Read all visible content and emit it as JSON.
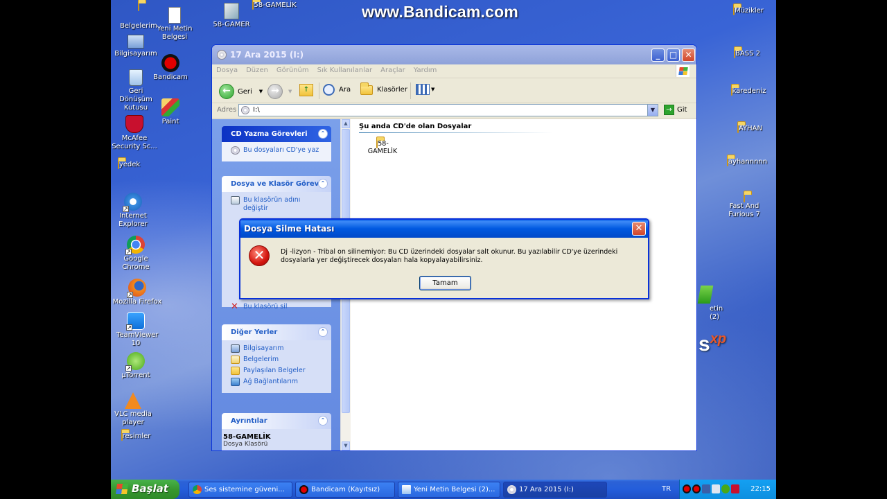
{
  "watermark": "www.Bandicam.com",
  "desktop_icons_left": [
    {
      "label": "Belgelerim",
      "icon": "my-documents-icon"
    },
    {
      "label": "Yeni Metin Belgesi",
      "icon": "text-document-icon"
    },
    {
      "label": "58-GAMER",
      "icon": "shortcut-icon"
    },
    {
      "label": "58-GAMELİK",
      "icon": "folder-icon"
    },
    {
      "label": "Bilgisayarım",
      "icon": "my-computer-icon"
    },
    {
      "label": "Bandicam",
      "icon": "bandicam-icon"
    },
    {
      "label": "Geri Dönüşüm Kutusu",
      "icon": "recycle-bin-icon"
    },
    {
      "label": "Paint",
      "icon": "paint-icon"
    },
    {
      "label": "McAfee Security Sc...",
      "icon": "mcafee-icon"
    },
    {
      "label": "yedek",
      "icon": "folder-icon"
    },
    {
      "label": "Internet Explorer",
      "icon": "internet-explorer-icon"
    },
    {
      "label": "Google Chrome",
      "icon": "chrome-icon"
    },
    {
      "label": "Mozilla Firefox",
      "icon": "firefox-icon"
    },
    {
      "label": "TeamViewer 10",
      "icon": "teamviewer-icon"
    },
    {
      "label": "µTorrent",
      "icon": "utorrent-icon"
    },
    {
      "label": "VLC media player",
      "icon": "vlc-icon"
    },
    {
      "label": "resimler",
      "icon": "folder-icon"
    }
  ],
  "desktop_icons_right": [
    {
      "label": "Müzikler"
    },
    {
      "label": "BASS 2"
    },
    {
      "label": "karedeniz"
    },
    {
      "label": "AYHAN"
    },
    {
      "label": "ayhannnnn"
    },
    {
      "label": "Fast And Furious 7"
    }
  ],
  "desktop_partial_label": "etin (2)",
  "xp_logo": {
    "text": "s",
    "sup": "xp"
  },
  "window": {
    "title": "17 Ara 2015 (I:)",
    "menu": [
      "Dosya",
      "Düzen",
      "Görünüm",
      "Sık Kullanılanlar",
      "Araçlar",
      "Yardım"
    ],
    "toolbar": {
      "back": "Geri",
      "search": "Ara",
      "folders": "Klasörler"
    },
    "address_label": "Adres",
    "address_value": "I:\\",
    "go_label": "Git",
    "panels": {
      "cd_tasks": {
        "title": "CD Yazma Görevleri",
        "items": [
          "Bu dosyaları CD'ye yaz"
        ]
      },
      "file_tasks": {
        "title": "Dosya ve Klasör Görevl",
        "items": [
          "Bu klasörün adını değiştir",
          "Bu klasörü sil"
        ]
      },
      "other_places": {
        "title": "Diğer Yerler",
        "items": [
          "Bilgisayarım",
          "Belgelerim",
          "Paylaşılan Belgeler",
          "Ağ Bağlantılarım"
        ]
      },
      "details": {
        "title": "Ayrıntılar",
        "name": "58-GAMELİK",
        "type": "Dosya Klasörü"
      }
    },
    "section_title": "Şu anda CD'de olan Dosyalar",
    "files": [
      {
        "name": "58-GAMELİK"
      }
    ]
  },
  "dialog": {
    "title": "Dosya Silme Hatası",
    "message": "Dj -lizyon - Tribal on silinemiyor: Bu CD üzerindeki dosyalar salt okunur.  Bu yazılabilir CD'ye üzerindeki dosyalarla yer değiştirecek dosyaları hala kopyalayabilirsiniz.",
    "ok_label": "Tamam"
  },
  "taskbar": {
    "start_label": "Başlat",
    "tasks": [
      {
        "label": "Ses sistemine güveni..."
      },
      {
        "label": "Bandicam (Kayıtsız)"
      },
      {
        "label": "Yeni Metin Belgesi (2)..."
      },
      {
        "label": "17 Ara 2015 (I:)"
      }
    ],
    "language": "TR",
    "clock": "22:15"
  }
}
